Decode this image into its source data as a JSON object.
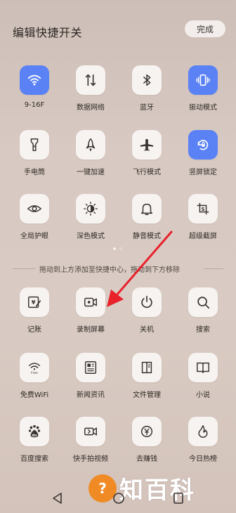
{
  "header": {
    "title": "编辑快捷开关",
    "done_label": "完成"
  },
  "page_dots": {
    "count": 2,
    "active_index": 0
  },
  "divider": {
    "text": "拖动到上方添加至快捷中心，拖动到下方移除"
  },
  "top_tiles": [
    {
      "label": "9-16F",
      "icon": "wifi-icon",
      "active": true
    },
    {
      "label": "数据网络",
      "icon": "mobile-data-icon",
      "active": false
    },
    {
      "label": "蓝牙",
      "icon": "bluetooth-icon",
      "active": false
    },
    {
      "label": "振动模式",
      "icon": "vibrate-icon",
      "active": true
    },
    {
      "label": "手电筒",
      "icon": "flashlight-icon",
      "active": false
    },
    {
      "label": "一键加速",
      "icon": "rocket-icon",
      "active": false
    },
    {
      "label": "飞行模式",
      "icon": "airplane-icon",
      "active": false
    },
    {
      "label": "竖屏锁定",
      "icon": "rotation-lock-icon",
      "active": true
    },
    {
      "label": "全局护眼",
      "icon": "eye-icon",
      "active": false
    },
    {
      "label": "深色模式",
      "icon": "dark-mode-icon",
      "active": false
    },
    {
      "label": "静音模式",
      "icon": "bell-icon",
      "active": false
    },
    {
      "label": "超级截屏",
      "icon": "screenshot-icon",
      "active": false
    }
  ],
  "bottom_tiles": [
    {
      "label": "记账",
      "icon": "bookkeeping-icon"
    },
    {
      "label": "录制屏幕",
      "icon": "screen-record-icon"
    },
    {
      "label": "关机",
      "icon": "power-icon"
    },
    {
      "label": "搜索",
      "icon": "search-icon"
    },
    {
      "label": "免费WiFi",
      "icon": "free-wifi-icon",
      "sub": "Free"
    },
    {
      "label": "新闻资讯",
      "icon": "news-icon"
    },
    {
      "label": "文件管理",
      "icon": "file-manager-icon"
    },
    {
      "label": "小说",
      "icon": "book-icon"
    },
    {
      "label": "百度搜索",
      "icon": "baidu-icon",
      "sub": "du"
    },
    {
      "label": "快手拍视频",
      "icon": "video-camera-icon"
    },
    {
      "label": "去赚钱",
      "icon": "yuan-icon"
    },
    {
      "label": "今日热榜",
      "icon": "flame-icon"
    }
  ],
  "nav": {
    "back": "back-icon",
    "home": "home-icon",
    "recents": "recents-icon"
  },
  "watermark": {
    "text": "知百科"
  },
  "colors": {
    "active_tile": "#5b82f5",
    "tile_bg": "#f7f3f1",
    "arrow": "#e8212b",
    "watermark_circle": "#f08a24"
  }
}
